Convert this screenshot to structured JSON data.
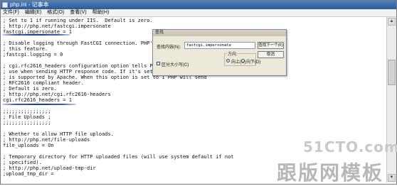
{
  "window": {
    "title": "php.ini - 记事本"
  },
  "menu": {
    "items": [
      "文件(F)",
      "编辑(E)",
      "格式(O)",
      "查看(V)",
      "帮助(H)"
    ]
  },
  "editor": {
    "lines": [
      "; Set to 1 if running under IIS.  Default is zero.",
      "; http://php.net/fastcgi.impersonate",
      "fastcgi.impersonate = 1",
      "",
      "; Disable logging through FastCGI connection. PHP's d",
      "; this feature.",
      ";fastcgi.logging = 0",
      "",
      "; cgi.rfc2616_headers configuration option tells PHP",
      "; use when sending HTTP response code. If it's set 0 P",
      "; is supported by Apache. When this option is set to 1 PHP will send",
      "; RFC2616 compliant header.",
      "; Default is zero.",
      "; http://php.net/cgi.rfc2616-headers",
      "cgi.rfc2616_headers = 1",
      "",
      ";;;;;;;;;;;;;;;;",
      "; File Uploads ;",
      ";;;;;;;;;;;;;;;;",
      "",
      "; Whether to allow HTTP file uploads.",
      "; http://php.net/file-uploads",
      "file_uploads = On",
      "",
      "; Temporary directory for HTTP uploaded files (will use system default if not",
      "; specified).",
      "; http://php.net/upload-tmp-dir",
      ";upload_tmp_dir ="
    ]
  },
  "find_dialog": {
    "title": "查找",
    "find_what_label": "查找内容(N):",
    "find_what_value": "fastcgi.impersonate",
    "find_next_label": "查找下一个(F)",
    "cancel_label": "取消",
    "direction_label": "方向",
    "up_label": "向上(U)",
    "down_label": "向下(D)",
    "match_case_label": "区分大小写(C)",
    "direction_selected": "up",
    "match_case_checked": false
  },
  "watermark": {
    "domain": "51CTO.com",
    "brand": "跟版网模板"
  },
  "colors": {
    "titlebar": "#2a5a9a",
    "underline": "#1c3f96",
    "dialog_bg": "#ece9d8"
  }
}
